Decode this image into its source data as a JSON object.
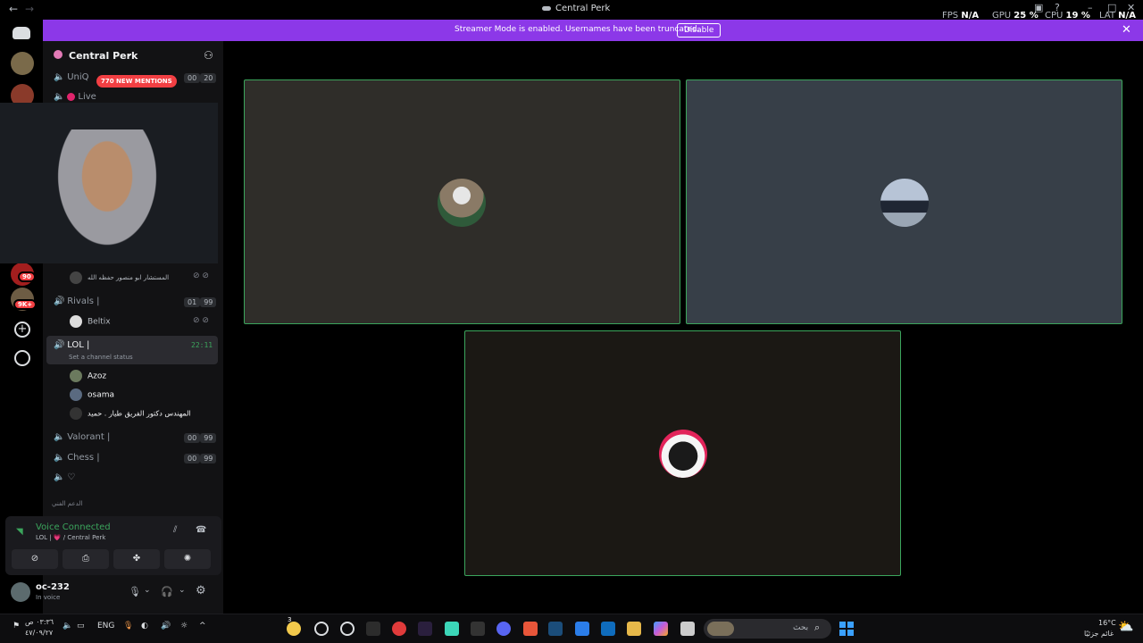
{
  "titlebar": {
    "title": "Central Perk",
    "back": "←",
    "forward": "→"
  },
  "stats": {
    "fps_label": "FPS",
    "fps_value": "N/A",
    "gpu_label": "GPU",
    "gpu_value": "25 %",
    "cpu_label": "CPU",
    "cpu_value": "19 %",
    "lat_label": "LAT",
    "lat_value": "N/A"
  },
  "banner": {
    "text": "Streamer Mode is enabled. Usernames have been truncated.",
    "button": "Disable"
  },
  "rail": {
    "badge_1": "90",
    "badge_2": "9K+"
  },
  "sidebar": {
    "server_name": "Central Perk",
    "mentions": "770 NEW MENTIONS",
    "channels": {
      "uniq": {
        "name": "UniQ",
        "count_a": "00",
        "count_b": "20"
      },
      "live": {
        "name": "Live"
      },
      "rivals": {
        "name": "Rivals |",
        "count_a": "01",
        "count_b": "99"
      },
      "lol": {
        "name": "LOL |",
        "timer": "22:11",
        "status": "Set a channel status"
      },
      "valorant": {
        "name": "Valorant |",
        "count_a": "00",
        "count_b": "99"
      },
      "chess": {
        "name": "Chess |",
        "count_a": "00",
        "count_b": "99"
      },
      "last": {
        "name": ""
      }
    },
    "users": {
      "above": "المستشار ابو منصور حفظه الله",
      "beltix": "Beltix",
      "azoz": "Azoz",
      "osama": "osama",
      "third": "المهندس دكتور الفريق طيار . حميد"
    },
    "category": "الدعم الفني"
  },
  "voice": {
    "status": "Voice Connected",
    "channel": "LOL | 💗 / Central Perk"
  },
  "user_panel": {
    "name": "oc-232",
    "status": "In voice"
  },
  "taskbar": {
    "time": "٠٣:٣٦ ص",
    "date": "٤٧/٠٩/٢٧",
    "lang": "ENG",
    "search_placeholder": "بحث",
    "weather_temp": "16°C",
    "weather_text": "غائم جزئيًا",
    "notif_count": "3"
  },
  "colors": {
    "accent_green": "#3ba55c",
    "banner_purple": "#8c38e8",
    "mention_red": "#f23f43"
  }
}
